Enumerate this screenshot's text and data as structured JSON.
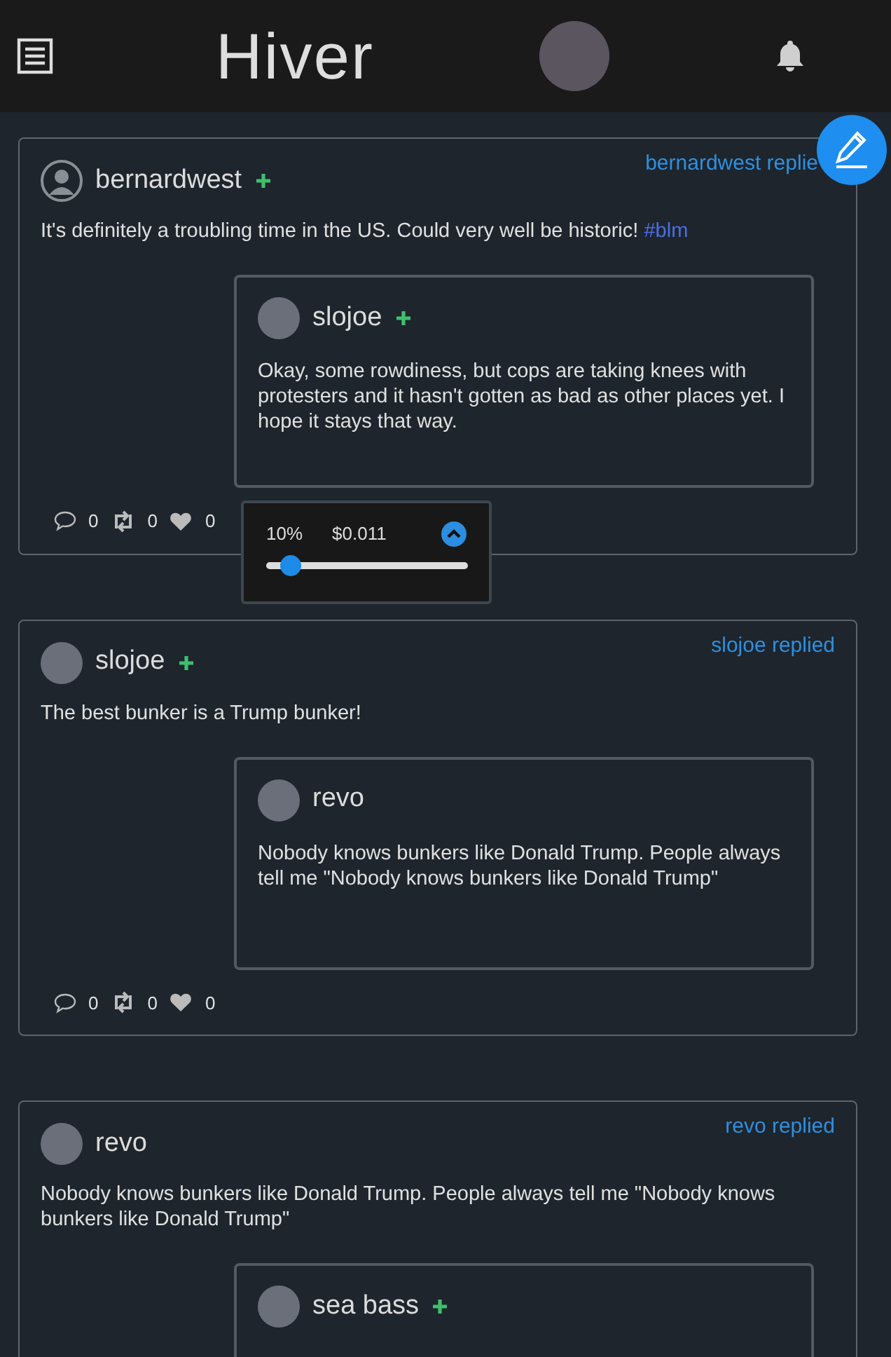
{
  "header": {
    "title": "Hiver"
  },
  "posts": [
    {
      "author": {
        "name": "bernardwest",
        "has_photo": false,
        "plus": true
      },
      "replied": "bernardwest replie",
      "text": "It's definitely a troubling time in the US. Could very well be historic!",
      "hashtag": "#blm",
      "quote": {
        "author": {
          "name": "slojoe",
          "has_photo": true,
          "plus": true
        },
        "text": "Okay, some rowdiness, but cops are taking knees with protesters and it hasn't gotten as bad as other places yet. I hope it stays that way."
      },
      "counts": {
        "comments": "0",
        "reposts": "0",
        "likes": "0"
      },
      "tip": {
        "percent": "10%",
        "amount": "$0.011",
        "level": 0.12,
        "expanded": true
      }
    },
    {
      "author": {
        "name": "slojoe",
        "has_photo": true,
        "plus": true
      },
      "replied": "slojoe replied",
      "text": "The best bunker is a Trump bunker!",
      "quote": {
        "author": {
          "name": "revo",
          "has_photo": true,
          "plus": false
        },
        "text": "Nobody knows bunkers like Donald Trump. People always tell me \"Nobody knows bunkers like Donald Trump\""
      },
      "counts": {
        "comments": "0",
        "reposts": "0",
        "likes": "0"
      }
    },
    {
      "author": {
        "name": "revo",
        "has_photo": true,
        "plus": false
      },
      "replied": "revo replied",
      "text": "Nobody knows bunkers like Donald Trump. People always tell me \"Nobody knows bunkers like Donald Trump\"",
      "quote": {
        "author": {
          "name": "sea bass",
          "has_photo": true,
          "plus": true
        }
      }
    }
  ]
}
